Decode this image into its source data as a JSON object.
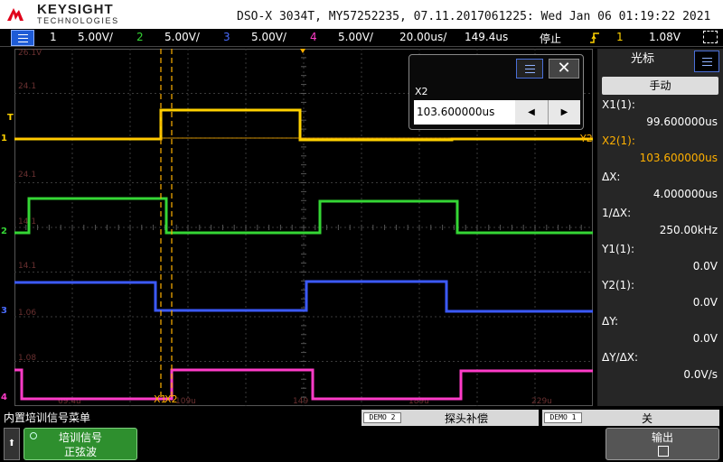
{
  "header": {
    "brand": "KEYSIGHT",
    "brand_sub": "TECHNOLOGIES",
    "scope_info": "DSO-X 3034T, MY57252235, 07.11.2017061225: Wed Jan 06 01:19:22 2021"
  },
  "channel_bar": {
    "ch1": {
      "num": "1",
      "scale": "5.00V/",
      "color": "#ffd200"
    },
    "ch2": {
      "num": "2",
      "scale": "5.00V/",
      "color": "#35d635"
    },
    "ch3": {
      "num": "3",
      "scale": "5.00V/",
      "color": "#3c5aff"
    },
    "ch4": {
      "num": "4",
      "scale": "5.00V/",
      "color": "#ff3cc8"
    },
    "timebase": "20.00us/",
    "delay": "149.4us",
    "run_state": "停止",
    "trigger_icon": "trigger-edge-icon",
    "trigger_source": "1",
    "trigger_level": "1.08V"
  },
  "grid": {
    "ch1_ref": "26.1V",
    "level_labels": [
      "24.1",
      "24.1",
      "14.1",
      "14.1",
      "1.06",
      "1.08"
    ],
    "time_labels": [
      "69.4u",
      "109u",
      "149",
      "189u",
      "229u"
    ],
    "channel_markers": [
      "1",
      "2",
      "3",
      "4"
    ],
    "trigger_marker": "T",
    "x1_tag": "X1",
    "x2_tag": "X2",
    "y2_tag": "Y2"
  },
  "cursor_dialog": {
    "label": "X2",
    "value": "103.600000us"
  },
  "right_panel": {
    "title": "光标",
    "mode": "手动",
    "x1_label": "X1(1):",
    "x1_value": "99.600000us",
    "x2_label": "X2(1):",
    "x2_value": "103.600000us",
    "dx_label": "ΔX:",
    "dx_value": "4.000000us",
    "inv_dx_label": "1/ΔX:",
    "inv_dx_value": "250.00kHz",
    "y1_label": "Y1(1):",
    "y1_value": "0.0V",
    "y2_label": "Y2(1):",
    "y2_value": "0.0V",
    "dy_label": "ΔY:",
    "dy_value": "0.0V",
    "dydx_label": "ΔY/ΔX:",
    "dydx_value": "0.0V/s"
  },
  "softkeys": {
    "menu_title": "内置培训信号菜单",
    "demo2_tag": "DEMO 2",
    "demo2_text": "探头补偿",
    "demo1_tag": "DEMO 1",
    "demo1_text": "关",
    "train_line1": "培训信号",
    "train_line2": "正弦波",
    "output_label": "输出"
  },
  "colors": {
    "x2_highlight": "#ffb000",
    "cursor_line": "#ffb000",
    "panel_bg": "#262626"
  }
}
